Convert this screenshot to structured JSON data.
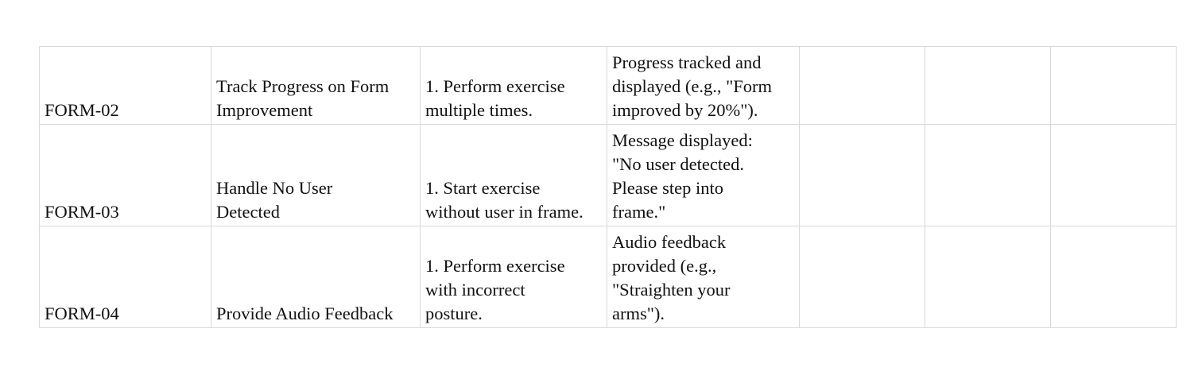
{
  "rows": [
    {
      "id": "FORM-02",
      "title": "Track Progress on Form\nImprovement",
      "steps": "1. Perform exercise\nmultiple times.",
      "expected": "Progress tracked and\ndisplayed (e.g., \"Form\nimproved by 20%\").",
      "extra1": "",
      "extra2": "",
      "extra3": ""
    },
    {
      "id": "FORM-03",
      "title": "Handle No User\nDetected",
      "steps": "1. Start exercise\nwithout user in frame.",
      "expected": "Message displayed:\n\"No user detected.\nPlease step into\nframe.\"",
      "extra1": "",
      "extra2": "",
      "extra3": ""
    },
    {
      "id": "FORM-04",
      "title": "Provide Audio Feedback",
      "steps": "1. Perform exercise\nwith incorrect\nposture.",
      "expected": "Audio feedback\nprovided (e.g.,\n\"Straighten your\narms\").",
      "extra1": "",
      "extra2": "",
      "extra3": ""
    }
  ]
}
